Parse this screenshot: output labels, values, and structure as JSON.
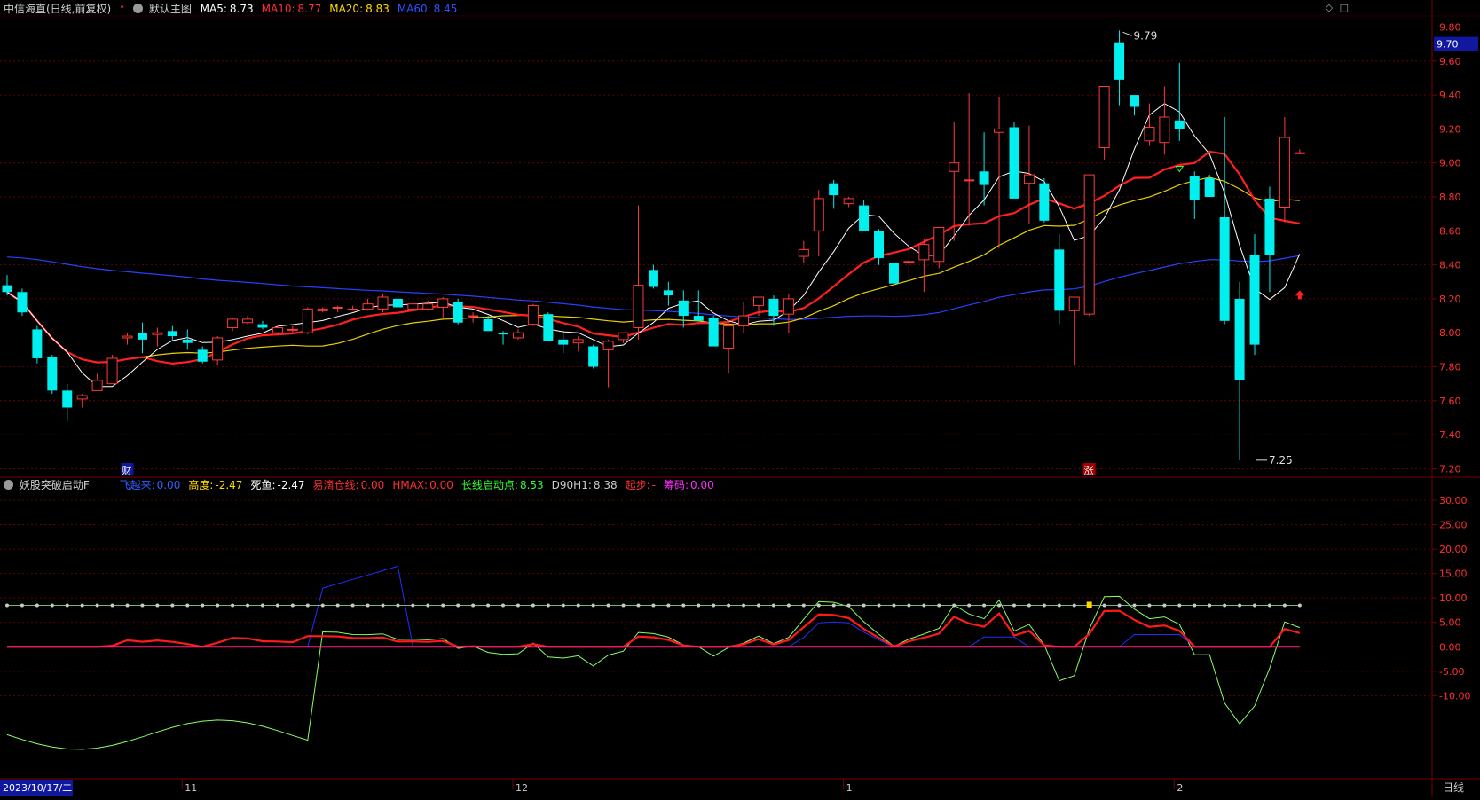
{
  "header": {
    "stock_title": "中信海直(日线,前复权)",
    "main_chart_label": "默认主图",
    "ma": [
      {
        "label": "MA5:",
        "value": "8.73",
        "color": "#ffffff"
      },
      {
        "label": "MA10:",
        "value": "8.77",
        "color": "#ff3030"
      },
      {
        "label": "MA20:",
        "value": "8.83",
        "color": "#ffd800"
      },
      {
        "label": "MA60:",
        "value": "8.45",
        "color": "#3050ff"
      }
    ]
  },
  "indicator": {
    "name": "妖股突破启动F",
    "items": [
      {
        "label": "飞越来:",
        "value": "0.00",
        "color": "#3060ff"
      },
      {
        "label": "高度:",
        "value": "-2.47",
        "color": "#ffd800"
      },
      {
        "label": "死鱼:",
        "value": "-2.47",
        "color": "#ffffff"
      },
      {
        "label": "易滴仓线:",
        "value": "0.00",
        "color": "#ff3030"
      },
      {
        "label": "HMAX:",
        "value": "0.00",
        "color": "#ff3030"
      },
      {
        "label": "长线启动点:",
        "value": "8.53",
        "color": "#30ff30"
      },
      {
        "label": "D90H1:",
        "value": "8.38",
        "color": "#cccccc"
      },
      {
        "label": "起步:",
        "value": "-",
        "color": "#ff3030"
      },
      {
        "label": "筹码:",
        "value": "0.00",
        "color": "#ff30ff"
      }
    ]
  },
  "price_axis": {
    "ticks": [
      "9.80",
      "9.60",
      "9.40",
      "9.20",
      "9.00",
      "8.80",
      "8.60",
      "8.40",
      "8.20",
      "8.00",
      "7.80",
      "7.60",
      "7.40",
      "7.20"
    ],
    "current_price": "9.70"
  },
  "indicator_axis": {
    "ticks": [
      "30.00",
      "25.00",
      "20.00",
      "15.00",
      "10.00",
      "5.00",
      "0.00",
      "-5.00",
      "-10.00"
    ]
  },
  "annotations": {
    "high_label": "9.79",
    "low_label": "7.25",
    "cai_badge": "财",
    "zhang_badge": "涨"
  },
  "time_axis": {
    "start_date": "2023/10/17/二",
    "months": [
      "11",
      "12",
      "1",
      "2"
    ],
    "period": "日线"
  },
  "colors": {
    "up": "#ff3a3a",
    "down": "#00f0f0",
    "grid": "#7a0000",
    "ma5": "#ffffff",
    "ma10": "#ff2020",
    "ma20": "#e8d000",
    "ma60": "#2a40ff"
  },
  "chart_data": {
    "type": "candlestick",
    "candles": [
      [
        8.28,
        8.34,
        8.22,
        8.24
      ],
      [
        8.24,
        8.26,
        8.1,
        8.12
      ],
      [
        8.02,
        8.04,
        7.82,
        7.85
      ],
      [
        7.86,
        7.87,
        7.64,
        7.66
      ],
      [
        7.66,
        7.7,
        7.48,
        7.56
      ],
      [
        7.61,
        7.64,
        7.56,
        7.63
      ],
      [
        7.66,
        7.76,
        7.66,
        7.72
      ],
      [
        7.7,
        7.87,
        7.7,
        7.85
      ],
      [
        7.97,
        8.0,
        7.93,
        7.98
      ],
      [
        8.0,
        8.06,
        7.88,
        7.96
      ],
      [
        7.99,
        8.03,
        7.92,
        8.0
      ],
      [
        8.01,
        8.04,
        7.96,
        7.98
      ],
      [
        7.96,
        8.02,
        7.9,
        7.94
      ],
      [
        7.9,
        7.92,
        7.82,
        7.83
      ],
      [
        7.84,
        7.98,
        7.81,
        7.97
      ],
      [
        8.03,
        8.09,
        8.01,
        8.08
      ],
      [
        8.06,
        8.1,
        8.05,
        8.08
      ],
      [
        8.05,
        8.07,
        8.02,
        8.03
      ],
      [
        8.0,
        8.04,
        7.99,
        8.03
      ],
      [
        8.02,
        8.04,
        8.0,
        8.02
      ],
      [
        8.0,
        8.15,
        7.99,
        8.14
      ],
      [
        8.13,
        8.15,
        8.12,
        8.14
      ],
      [
        8.15,
        8.16,
        8.12,
        8.15
      ],
      [
        8.14,
        8.16,
        8.13,
        8.14
      ],
      [
        8.14,
        8.2,
        8.13,
        8.17
      ],
      [
        8.14,
        8.23,
        8.12,
        8.21
      ],
      [
        8.2,
        8.21,
        8.14,
        8.15
      ],
      [
        8.14,
        8.18,
        8.13,
        8.17
      ],
      [
        8.14,
        8.19,
        8.13,
        8.17
      ],
      [
        8.15,
        8.21,
        8.09,
        8.2
      ],
      [
        8.18,
        8.2,
        8.05,
        8.06
      ],
      [
        8.1,
        8.12,
        8.06,
        8.1
      ],
      [
        8.08,
        8.1,
        8.01,
        8.01
      ],
      [
        8.0,
        8.01,
        7.93,
        7.99
      ],
      [
        7.97,
        8.02,
        7.96,
        8.0
      ],
      [
        8.05,
        8.17,
        8.04,
        8.16
      ],
      [
        8.11,
        8.12,
        7.95,
        7.95
      ],
      [
        7.96,
        8.0,
        7.88,
        7.93
      ],
      [
        7.94,
        7.98,
        7.89,
        7.96
      ],
      [
        7.92,
        7.93,
        7.79,
        7.8
      ],
      [
        7.9,
        7.96,
        7.68,
        7.95
      ],
      [
        7.96,
        8.0,
        7.94,
        8.0
      ],
      [
        8.03,
        8.75,
        7.96,
        8.28
      ],
      [
        8.37,
        8.4,
        8.26,
        8.27
      ],
      [
        8.25,
        8.3,
        8.16,
        8.22
      ],
      [
        8.19,
        8.25,
        8.03,
        8.1
      ],
      [
        8.1,
        8.25,
        8.08,
        8.07
      ],
      [
        8.09,
        8.1,
        7.92,
        7.92
      ],
      [
        7.91,
        8.07,
        7.76,
        8.04
      ],
      [
        8.04,
        8.18,
        8.0,
        8.1
      ],
      [
        8.16,
        8.2,
        8.1,
        8.21
      ],
      [
        8.2,
        8.22,
        8.04,
        8.1
      ],
      [
        8.11,
        8.23,
        8.0,
        8.2
      ],
      [
        8.45,
        8.54,
        8.41,
        8.49
      ],
      [
        8.6,
        8.84,
        8.45,
        8.79
      ],
      [
        8.88,
        8.9,
        8.73,
        8.81
      ],
      [
        8.76,
        8.8,
        8.74,
        8.79
      ],
      [
        8.75,
        8.78,
        8.6,
        8.6
      ],
      [
        8.6,
        8.61,
        8.4,
        8.44
      ],
      [
        8.41,
        8.42,
        8.3,
        8.29
      ],
      [
        8.42,
        8.55,
        8.3,
        8.42
      ],
      [
        8.43,
        8.55,
        8.24,
        8.52
      ],
      [
        8.42,
        8.6,
        8.38,
        8.62
      ],
      [
        8.95,
        9.24,
        8.54,
        9.0
      ],
      [
        8.9,
        9.41,
        8.63,
        8.9
      ],
      [
        8.95,
        9.18,
        8.75,
        8.87
      ],
      [
        9.18,
        9.39,
        8.5,
        9.2
      ],
      [
        9.21,
        9.24,
        8.87,
        8.79
      ],
      [
        8.88,
        9.22,
        8.64,
        8.93
      ],
      [
        8.88,
        8.91,
        8.65,
        8.66
      ],
      [
        8.49,
        8.58,
        8.05,
        8.13
      ],
      [
        8.13,
        8.21,
        7.81,
        8.21
      ],
      [
        8.11,
        8.82,
        8.1,
        8.93
      ],
      [
        9.09,
        9.38,
        9.02,
        9.45
      ],
      [
        9.71,
        9.78,
        9.34,
        9.49
      ],
      [
        9.4,
        9.4,
        9.28,
        9.33
      ],
      [
        9.13,
        9.35,
        9.1,
        9.21
      ],
      [
        9.12,
        9.45,
        9.05,
        9.27
      ],
      [
        9.25,
        9.59,
        9.13,
        9.2
      ],
      [
        8.92,
        8.95,
        8.67,
        8.78
      ],
      [
        8.91,
        8.93,
        8.81,
        8.8
      ],
      [
        8.68,
        9.27,
        8.05,
        8.07
      ],
      [
        8.2,
        8.3,
        7.25,
        7.72
      ],
      [
        8.46,
        8.58,
        7.87,
        7.93
      ],
      [
        8.79,
        8.86,
        8.24,
        8.46
      ],
      [
        8.74,
        9.27,
        8.65,
        9.15
      ],
      [
        9.06,
        9.08,
        9.06,
        9.06
      ]
    ],
    "price_range": [
      7.15,
      9.86
    ],
    "indicator_range": [
      -27,
      34
    ]
  }
}
